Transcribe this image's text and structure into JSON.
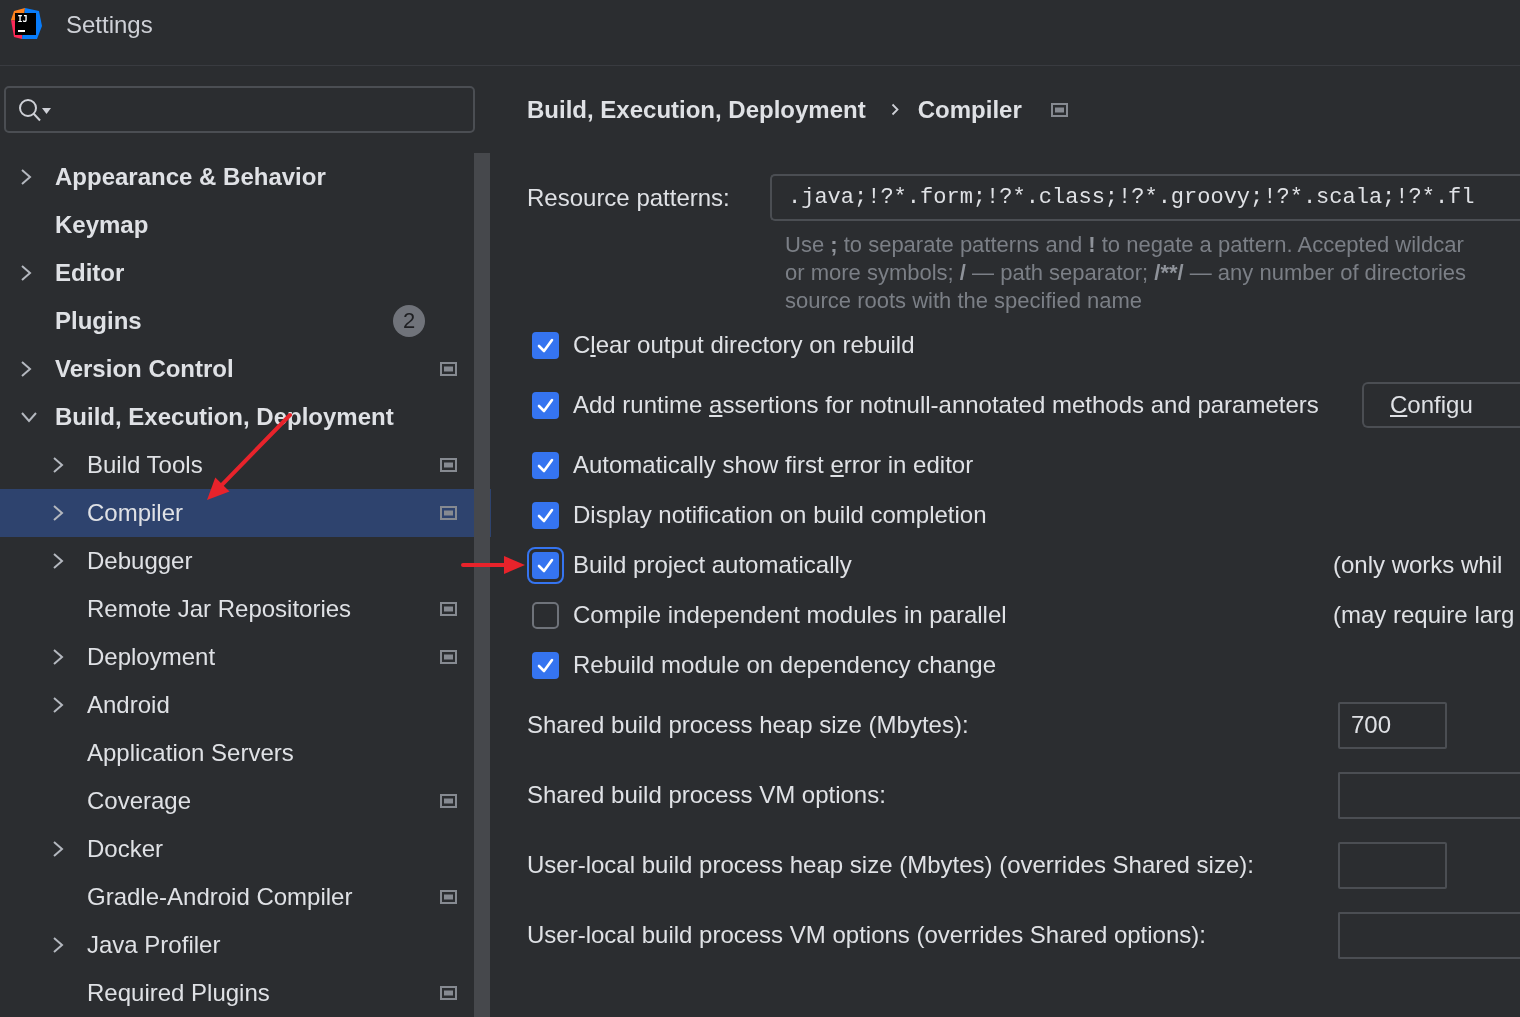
{
  "window": {
    "title": "Settings",
    "logo_text": "IJ"
  },
  "search": {
    "has_history": true
  },
  "sidebar": {
    "items": [
      {
        "label": "Appearance & Behavior",
        "expanded": false,
        "project_level": false,
        "selected": false
      },
      {
        "label": "Keymap",
        "project_level": false,
        "selected": false
      },
      {
        "label": "Editor",
        "expanded": false,
        "project_level": false,
        "selected": false
      },
      {
        "label": "Plugins",
        "project_level": false,
        "selected": false,
        "badge": "2"
      },
      {
        "label": "Version Control",
        "expanded": false,
        "project_level": true,
        "selected": false
      },
      {
        "label": "Build, Execution, Deployment",
        "expanded": true,
        "project_level": false,
        "selected": false,
        "children": [
          {
            "label": "Build Tools",
            "expanded": false,
            "project_level": true,
            "selected": false
          },
          {
            "label": "Compiler",
            "expanded": false,
            "project_level": true,
            "selected": true
          },
          {
            "label": "Debugger",
            "expanded": false,
            "project_level": false,
            "selected": false
          },
          {
            "label": "Remote Jar Repositories",
            "project_level": true,
            "selected": false
          },
          {
            "label": "Deployment",
            "expanded": false,
            "project_level": true,
            "selected": false
          },
          {
            "label": "Android",
            "expanded": false,
            "project_level": false,
            "selected": false
          },
          {
            "label": "Application Servers",
            "project_level": false,
            "selected": false
          },
          {
            "label": "Coverage",
            "project_level": true,
            "selected": false
          },
          {
            "label": "Docker",
            "expanded": false,
            "project_level": false,
            "selected": false
          },
          {
            "label": "Gradle-Android Compiler",
            "project_level": true,
            "selected": false
          },
          {
            "label": "Java Profiler",
            "expanded": false,
            "project_level": false,
            "selected": false
          },
          {
            "label": "Required Plugins",
            "project_level": true,
            "selected": false
          }
        ]
      }
    ]
  },
  "breadcrumb": {
    "items": [
      {
        "label": "Build, Execution, Deployment"
      },
      {
        "label": "Compiler"
      }
    ],
    "project_level": true
  },
  "resource_patterns": {
    "label": "Resource patterns:",
    "value": ".java;!?*.form;!?*.class;!?*.groovy;!?*.scala;!?*.fl",
    "hint_lines": [
      [
        {
          "text": "Use ",
          "bold": false
        },
        {
          "text": ";",
          "bold": true
        },
        {
          "text": " to separate patterns and ",
          "bold": false
        },
        {
          "text": "!",
          "bold": true
        },
        {
          "text": " to negate a pattern. Accepted wildcar",
          "bold": false
        }
      ],
      [
        {
          "text": "or more symbols; ",
          "bold": false
        },
        {
          "text": "/",
          "bold": true
        },
        {
          "text": " — path separator; ",
          "bold": false
        },
        {
          "text": "/**/",
          "bold": true
        },
        {
          "text": " — any number of directories",
          "bold": false
        }
      ],
      [
        {
          "text": "source roots with the specified name",
          "bold": false
        }
      ]
    ]
  },
  "options": [
    {
      "label": [
        {
          "text": "C",
          "underlined": false
        },
        {
          "text": "l",
          "underlined": true
        },
        {
          "text": "ear output directory on rebuild",
          "underlined": false
        }
      ],
      "checked": true,
      "focused": false
    },
    {
      "label": [
        {
          "text": "Add runtime ",
          "underlined": false
        },
        {
          "text": "a",
          "underlined": true
        },
        {
          "text": "ssertions for notnull-annotated methods and parameters",
          "underlined": false
        }
      ],
      "checked": true,
      "focused": false,
      "button": {
        "label": [
          {
            "text": "C",
            "underlined": true
          },
          {
            "text": "onfigu",
            "underlined": false
          }
        ]
      }
    },
    {
      "label": [
        {
          "text": "Automatically show first ",
          "underlined": false
        },
        {
          "text": "e",
          "underlined": true
        },
        {
          "text": "rror in editor",
          "underlined": false
        }
      ],
      "checked": true,
      "focused": false
    },
    {
      "label": "Display notification on build completion",
      "checked": true,
      "focused": false
    },
    {
      "label": "Build project automatically",
      "checked": true,
      "focused": true,
      "note": "(only works whil"
    },
    {
      "label": "Compile independent modules in parallel",
      "checked": false,
      "focused": false,
      "note": "(may require larg"
    },
    {
      "label": "Rebuild module on dependency change",
      "checked": true,
      "focused": false
    }
  ],
  "fields": [
    {
      "label": "Shared build process heap size (Mbytes):",
      "kind": "number",
      "value": "700"
    },
    {
      "label": "Shared build process VM options:",
      "kind": "text"
    },
    {
      "label": "User-local build process heap size (Mbytes) (overrides Shared size):",
      "kind": "number"
    },
    {
      "label": "User-local build process VM options (overrides Shared options):",
      "kind": "text"
    }
  ]
}
